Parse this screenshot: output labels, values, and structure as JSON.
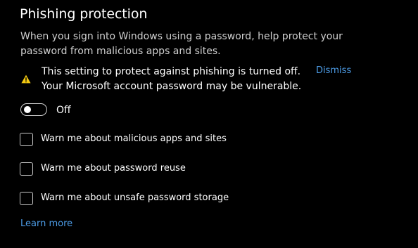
{
  "section": {
    "title": "Phishing protection",
    "description": "When you sign into Windows using a password, help protect your password from malicious apps and sites."
  },
  "warning": {
    "icon": "warning-triangle-icon",
    "text": "This setting to protect against phishing is turned off. Your Microsoft account password may be vulnerable.",
    "dismiss_label": "Dismiss"
  },
  "toggle": {
    "label": "Off",
    "state": "off"
  },
  "options": [
    {
      "label": "Warn me about malicious apps and sites",
      "checked": false
    },
    {
      "label": "Warn me about password reuse",
      "checked": false
    },
    {
      "label": "Warn me about unsafe password storage",
      "checked": false
    }
  ],
  "learn_more_label": "Learn more",
  "colors": {
    "background": "#000000",
    "accent_link": "#4d9de8",
    "warning_yellow": "#f2c811",
    "text": "#ffffff",
    "secondary_text": "#cfcfcf"
  }
}
